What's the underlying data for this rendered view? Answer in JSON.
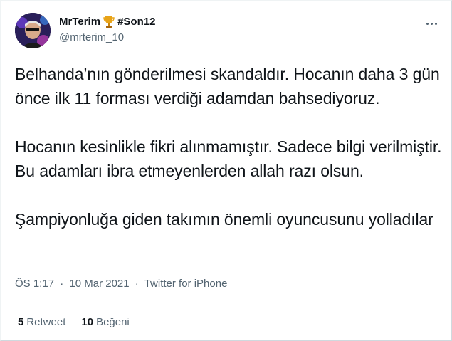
{
  "user": {
    "display_name": "MrTerim",
    "hashtag": "#Son12",
    "handle": "@mrterim_10",
    "badge_icon": "trophy-icon"
  },
  "tweet": {
    "paragraphs": [
      "Belhanda’nın gönderilmesi skandaldır. Hocanın daha 3 gün önce ilk 11 forması verdiği adamdan bahsediyoruz.",
      "Hocanın kesinlikle fikri alınmamıştır. Sadece bilgi verilmiştir. Bu adamları ibra etmeyenlerden allah razı olsun.",
      "Şampiyonluğa giden takımın önemli oyuncusunu yolladılar"
    ],
    "time": "ÖS 1:17",
    "date": "10 Mar 2021",
    "source": "Twitter for iPhone",
    "separator": "·"
  },
  "stats": {
    "retweets_count": "5",
    "retweets_label": "Retweet",
    "likes_count": "10",
    "likes_label": "Beğeni"
  },
  "colors": {
    "text": "#0f1419",
    "secondary": "#536471",
    "border": "#eff3f4"
  }
}
